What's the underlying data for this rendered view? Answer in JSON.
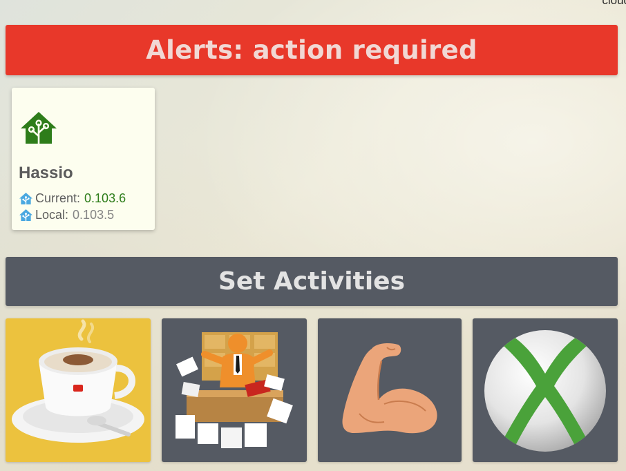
{
  "header": {
    "corner_text": "cloud"
  },
  "alerts": {
    "title": "Alerts: action required"
  },
  "update_card": {
    "title": "Hassio",
    "current_label": "Current:",
    "current_version": "0.103.6",
    "local_label": "Local:",
    "local_version": "0.103.5",
    "icon": "home-assistant-icon"
  },
  "activities": {
    "title": "Set Activities",
    "tiles": [
      {
        "name": "coffee",
        "icon": "coffee-cup-icon"
      },
      {
        "name": "work",
        "icon": "paperwork-icon"
      },
      {
        "name": "gym",
        "icon": "flexed-arm-icon"
      },
      {
        "name": "xbox",
        "icon": "xbox-icon"
      }
    ]
  },
  "colors": {
    "alert": "#e8382a",
    "section": "#555a63",
    "card": "#fdfeef",
    "coffee_tile": "#ecc23e",
    "ha_green": "#2e7d1a",
    "ha_blue": "#4aa8e0"
  }
}
